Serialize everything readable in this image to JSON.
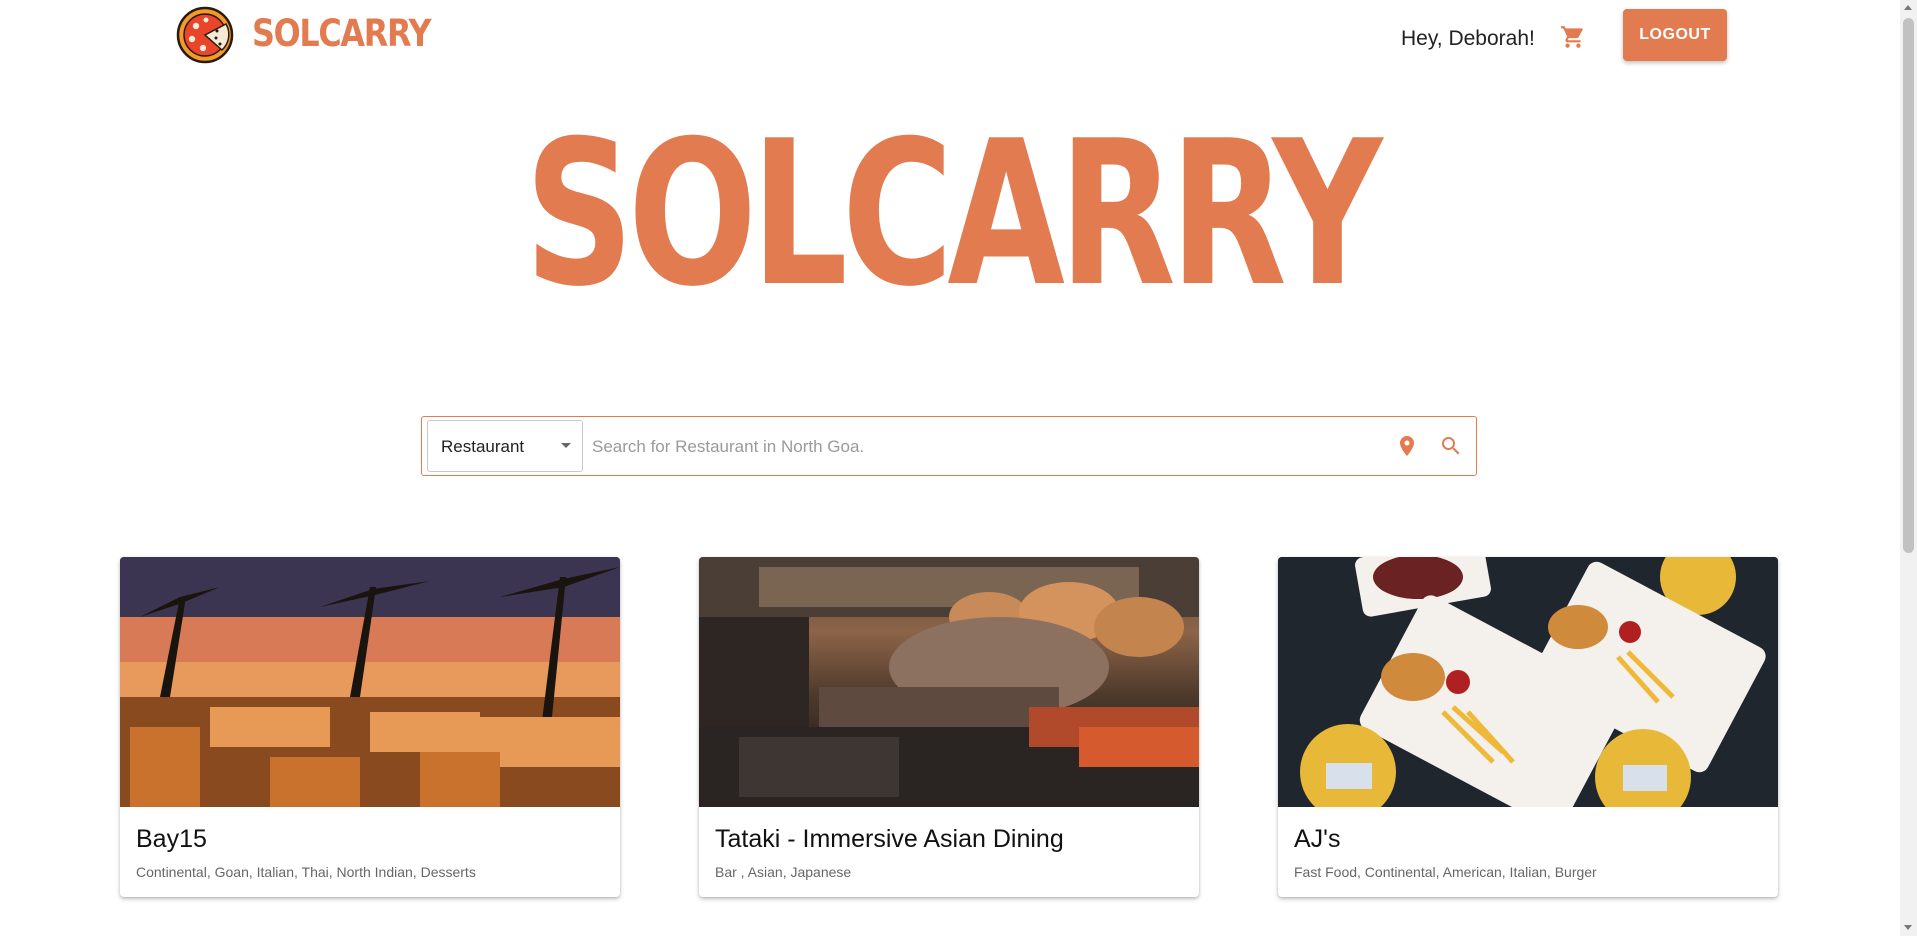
{
  "header": {
    "brand": "SOLCARRY",
    "greeting": "Hey,  Deborah!",
    "cart_icon": "cart-icon",
    "logout_label": "LOGOUT"
  },
  "hero": {
    "title": "SOLCARRY"
  },
  "search": {
    "type_selected": "Restaurant",
    "placeholder": "Search for Restaurant in North Goa.",
    "value": "",
    "location_icon": "location-pin-icon",
    "search_icon": "search-icon"
  },
  "restaurants": [
    {
      "name": "Bay15",
      "cuisines": "Continental, Goan, Italian, Thai, North Indian, Desserts"
    },
    {
      "name": "Tataki - Immersive Asian Dining",
      "cuisines": "Bar , Asian, Japanese"
    },
    {
      "name": "AJ's",
      "cuisines": "Fast Food, Continental, American, Italian, Burger"
    }
  ],
  "colors": {
    "accent": "#e27b50",
    "text": "#222222",
    "muted": "#666666"
  }
}
